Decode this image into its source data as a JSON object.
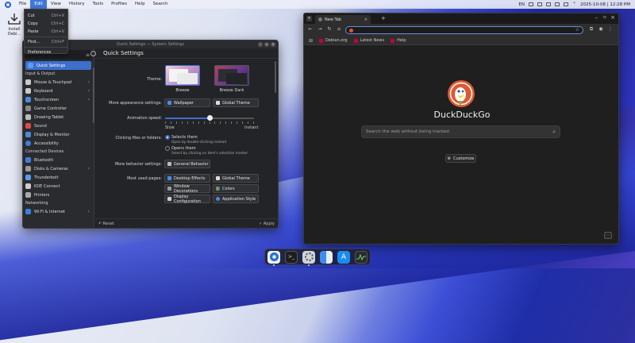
{
  "menubar": {
    "items": [
      "File",
      "Edit",
      "View",
      "History",
      "Tools",
      "Profiles",
      "Help",
      "Search"
    ],
    "active": "Edit",
    "lang": "EN",
    "clock": "2025-10-08 | 12:28 PM"
  },
  "edit_menu": {
    "items": [
      {
        "label": "Cut",
        "shortcut": "Ctrl+X"
      },
      {
        "label": "Copy",
        "shortcut": "Ctrl+C"
      },
      {
        "label": "Paste",
        "shortcut": "Ctrl+V"
      },
      {
        "label": "Find...",
        "shortcut": "Ctrl+F"
      },
      {
        "label": "Preferences",
        "shortcut": ""
      }
    ]
  },
  "desktop": {
    "install_label": "Install Debi..."
  },
  "settings": {
    "title": "Quick Settings — System Settings",
    "page_title": "Quick Settings",
    "sidebar": {
      "selected": "Quick Settings",
      "groups": [
        {
          "heading": "Input & Output",
          "items": [
            "Mouse & Touchpad",
            "Keyboard",
            "Touchscreen",
            "Game Controller",
            "Drawing Tablet",
            "Sound",
            "Display & Monitor",
            "Accessibility"
          ]
        },
        {
          "heading": "Connected Devices",
          "items": [
            "Bluetooth",
            "Disks & Cameras",
            "Thunderbolt",
            "KDE Connect",
            "Printers"
          ]
        },
        {
          "heading": "Networking",
          "items": [
            "Wi-Fi & Internet"
          ]
        }
      ]
    },
    "theme_label": "Theme:",
    "themes": [
      {
        "name": "Breeze",
        "selected": true
      },
      {
        "name": "Breeze Dark",
        "selected": false
      }
    ],
    "more_appearance_label": "More appearance settings:",
    "wallpaper_btn": "Wallpaper",
    "global_theme_btn": "Global Theme",
    "animation_label": "Animation speed:",
    "animation_level": 0.5,
    "slow": "Slow",
    "instant": "Instant",
    "clicking_label": "Clicking files or folders:",
    "radio1": "Selects them",
    "radio1_sub": "Open by double-clicking instead",
    "radio2": "Opens them",
    "radio2_sub": "Select by clicking on item's selection marker",
    "more_behavior_label": "More behavior settings:",
    "general_behavior_btn": "General Behavior",
    "most_used_label": "Most used pages:",
    "pages": [
      "Desktop Effects",
      "Global Theme",
      "Window Decorations",
      "Colors",
      "Display Configuration",
      "Application Style"
    ],
    "reset": "Reset",
    "apply": "Apply"
  },
  "browser": {
    "tab_title": "New Tab",
    "bookmarks": [
      "Debian.org",
      "Latest News",
      "Help"
    ],
    "brand": "DuckDuckGo",
    "search_placeholder": "Search the web without being tracked",
    "customize": "Customize"
  },
  "colors": {
    "accent": "#3d6fcb",
    "ddg_orange": "#de5833"
  }
}
